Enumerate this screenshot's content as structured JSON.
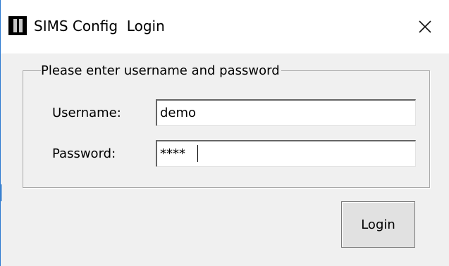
{
  "window": {
    "app_name": "SIMS Config",
    "dialog_title": "Login",
    "close_glyph": "✕",
    "icon": "sims-app-icon"
  },
  "group": {
    "legend": "Please enter username and password"
  },
  "fields": {
    "username_label": "Username:",
    "username_value": "demo",
    "password_label": "Password:",
    "password_value": "****"
  },
  "actions": {
    "login_label": "Login"
  },
  "colors": {
    "window_bg": "#f0f0f0",
    "titlebar_bg": "#ffffff",
    "window_border": "#2b79d0",
    "button_bg": "#e1e1e1",
    "button_border": "#7a7a7a"
  }
}
